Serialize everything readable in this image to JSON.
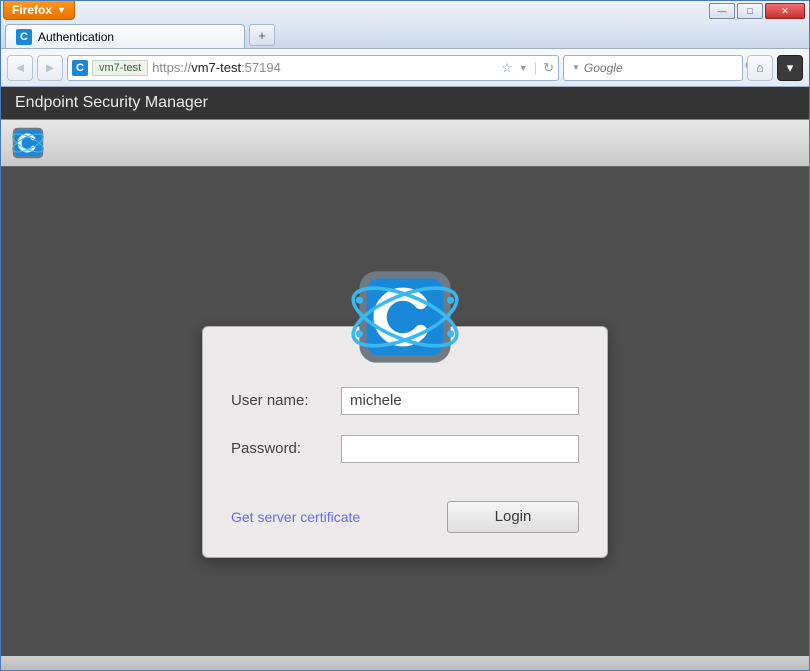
{
  "browser": {
    "name": "Firefox",
    "tab_title": "Authentication",
    "site_identity": "vm7-test",
    "url_display": "https://vm7-test:57194",
    "url_prefix": "https://",
    "url_host": "vm7-test",
    "url_suffix": ":57194",
    "search_placeholder": "Google"
  },
  "app": {
    "title": "Endpoint Security Manager"
  },
  "login": {
    "username_label": "User name:",
    "password_label": "Password:",
    "username_value": "michele",
    "password_value": "",
    "cert_link": "Get server certificate",
    "login_button": "Login"
  }
}
